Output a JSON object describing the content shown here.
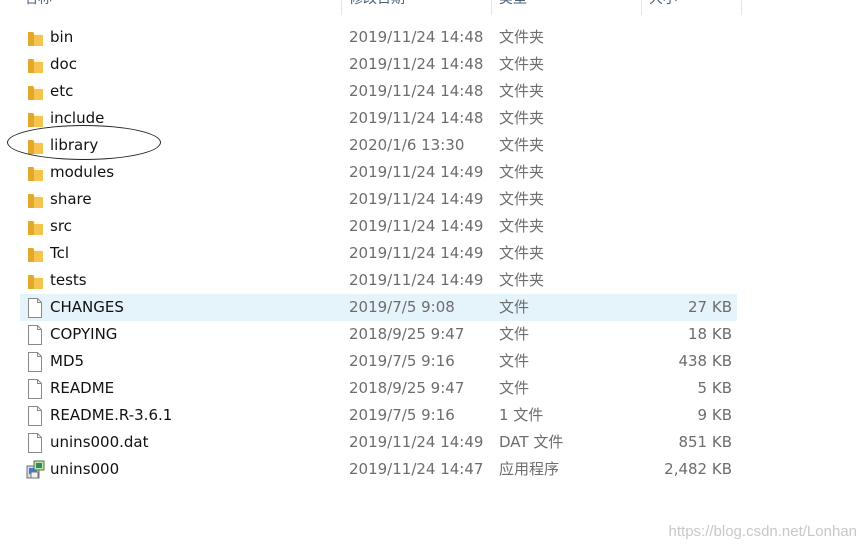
{
  "header": {
    "name": "名称",
    "date": "修改日期",
    "type": "类型",
    "size": "大小"
  },
  "files": [
    {
      "name": "bin",
      "date": "2019/11/24 14:48",
      "type": "文件夹",
      "size": "",
      "icon": "folder-icon"
    },
    {
      "name": "doc",
      "date": "2019/11/24 14:48",
      "type": "文件夹",
      "size": "",
      "icon": "folder-icon"
    },
    {
      "name": "etc",
      "date": "2019/11/24 14:48",
      "type": "文件夹",
      "size": "",
      "icon": "folder-icon"
    },
    {
      "name": "include",
      "date": "2019/11/24 14:48",
      "type": "文件夹",
      "size": "",
      "icon": "folder-icon"
    },
    {
      "name": "library",
      "date": "2020/1/6 13:30",
      "type": "文件夹",
      "size": "",
      "icon": "folder-icon"
    },
    {
      "name": "modules",
      "date": "2019/11/24 14:49",
      "type": "文件夹",
      "size": "",
      "icon": "folder-icon"
    },
    {
      "name": "share",
      "date": "2019/11/24 14:49",
      "type": "文件夹",
      "size": "",
      "icon": "folder-icon"
    },
    {
      "name": "src",
      "date": "2019/11/24 14:49",
      "type": "文件夹",
      "size": "",
      "icon": "folder-icon"
    },
    {
      "name": "Tcl",
      "date": "2019/11/24 14:49",
      "type": "文件夹",
      "size": "",
      "icon": "folder-icon"
    },
    {
      "name": "tests",
      "date": "2019/11/24 14:49",
      "type": "文件夹",
      "size": "",
      "icon": "folder-icon"
    },
    {
      "name": "CHANGES",
      "date": "2019/7/5 9:08",
      "type": "文件",
      "size": "27 KB",
      "icon": "file-icon"
    },
    {
      "name": "COPYING",
      "date": "2018/9/25 9:47",
      "type": "文件",
      "size": "18 KB",
      "icon": "file-icon"
    },
    {
      "name": "MD5",
      "date": "2019/7/5 9:16",
      "type": "文件",
      "size": "438 KB",
      "icon": "file-icon"
    },
    {
      "name": "README",
      "date": "2018/9/25 9:47",
      "type": "文件",
      "size": "5 KB",
      "icon": "file-icon"
    },
    {
      "name": "README.R-3.6.1",
      "date": "2019/7/5 9:16",
      "type": "1 文件",
      "size": "9 KB",
      "icon": "file-icon"
    },
    {
      "name": "unins000.dat",
      "date": "2019/11/24 14:49",
      "type": "DAT 文件",
      "size": "851 KB",
      "icon": "file-icon"
    },
    {
      "name": "unins000",
      "date": "2019/11/24 14:47",
      "type": "应用程序",
      "size": "2,482 KB",
      "icon": "uninstaller-icon"
    }
  ],
  "selected_row": "CHANGES",
  "annotation_target": "library",
  "watermark": "https://blog.csdn.net/Lonhan",
  "colors": {
    "folder": "#f4c44e",
    "folder_dark": "#e2a829",
    "selection": "#e5f3fb",
    "secondary_text": "#6d6d6d"
  }
}
